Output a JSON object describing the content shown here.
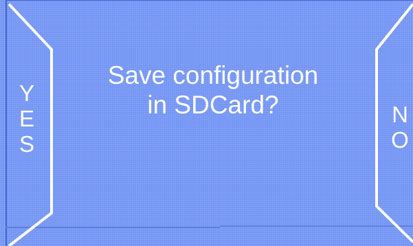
{
  "dialog": {
    "prompt_lines": [
      "Save configuration",
      "in SDCard?"
    ]
  },
  "buttons": {
    "yes_letters": [
      "Y",
      "E",
      "S"
    ],
    "no_letters": [
      "N",
      "O"
    ]
  },
  "colors": {
    "background": "#7395f4",
    "outline": "#ffffff",
    "text": "#ffffff"
  }
}
